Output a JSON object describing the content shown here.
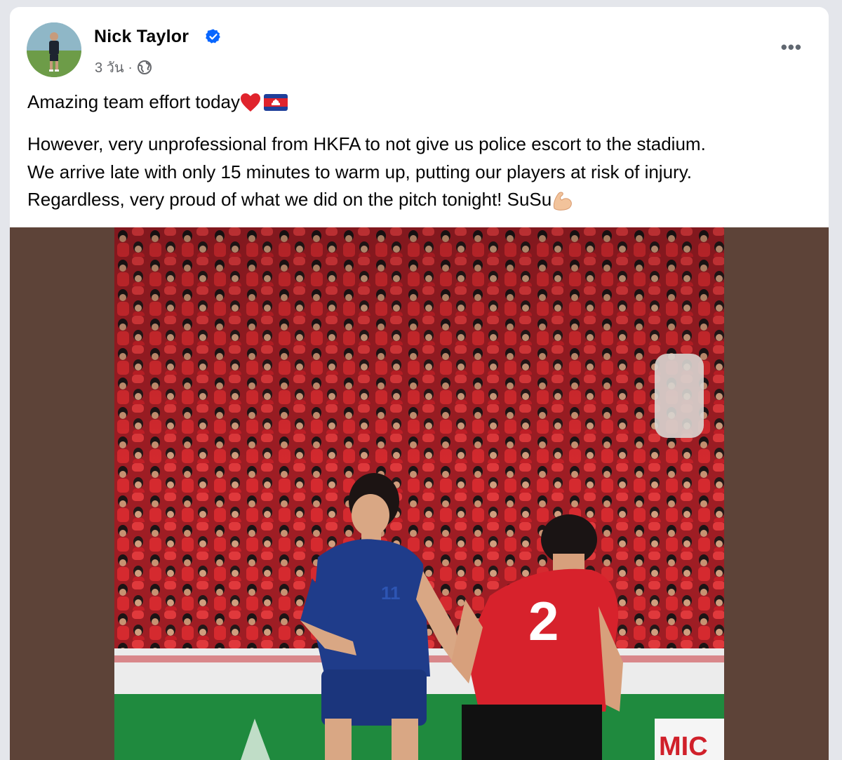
{
  "post": {
    "author": "Nick Taylor",
    "time": "3 วัน",
    "separator": "·",
    "more_label": "•••",
    "line1": "Amazing team effort today",
    "body_lines": [
      "However, very unprofessional from HKFA to not give us police escort to the stadium.",
      "We arrive late with only 15 minutes to warm up, putting our players at risk of injury.",
      "Regardless, very proud of what we did on the pitch tonight! SuSu"
    ],
    "icons": {
      "verified": "verified-badge-icon",
      "privacy": "globe-icon",
      "heart": "red-heart-emoji",
      "flag": "cambodia-flag-emoji",
      "arm": "flexed-biceps-emoji"
    }
  },
  "photo": {
    "jersey_number_blue": "11",
    "jersey_number_red": "2",
    "banner_text": "MIC"
  },
  "colors": {
    "verified_blue": "#0866ff",
    "media_background": "#5d4338",
    "crowd_red": "#c8202a",
    "blue_kit": "#1f3c8a",
    "red_kit": "#d7222c"
  }
}
